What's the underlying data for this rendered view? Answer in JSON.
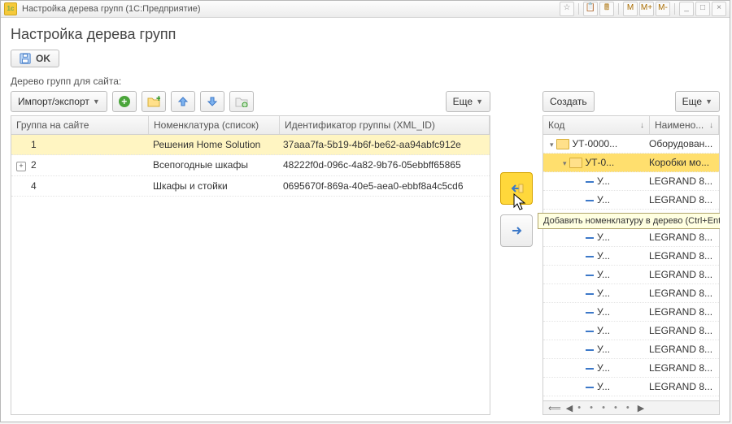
{
  "window": {
    "title": "Настройка дерева групп  (1С:Предприятие)"
  },
  "titlebar_buttons": [
    "☆",
    "📄",
    "🖩",
    "M",
    "M+",
    "M-",
    "_",
    "×"
  ],
  "page": {
    "heading": "Настройка дерева групп"
  },
  "ok_button": {
    "label": "OK"
  },
  "tree_label": "Дерево групп для сайта:",
  "left_toolbar": {
    "import_export": "Импорт/экспорт",
    "more": "Еще"
  },
  "left_table": {
    "headers": [
      "Группа на сайте",
      "Номенклатура (список)",
      "Идентификатор группы (XML_ID)"
    ],
    "rows": [
      {
        "num": "1",
        "expand": false,
        "nomen": "Решения Home Solution",
        "xml": "37aaa7fa-5b19-4b6f-be62-aa94abfc912e",
        "selected": true
      },
      {
        "num": "2",
        "expand": true,
        "nomen": "Всепогодные шкафы",
        "xml": "48222f0d-096c-4a82-9b76-05ebbff65865",
        "selected": false
      },
      {
        "num": "4",
        "expand": false,
        "nomen": "Шкафы и стойки",
        "xml": "0695670f-869a-40e5-aea0-ebbf8a4c5cd6",
        "selected": false
      }
    ]
  },
  "mid": {
    "tooltip": "Добавить номенклатуру в дерево (Ctrl+Enter)"
  },
  "right_toolbar": {
    "create": "Создать",
    "more": "Еще"
  },
  "right_table": {
    "headers": [
      "Код",
      "Наимено..."
    ],
    "rows": [
      {
        "level": 0,
        "type": "folder",
        "caret": "▾",
        "code": "УТ-0000...",
        "name": "Оборудован...",
        "selected": false
      },
      {
        "level": 1,
        "type": "folder",
        "caret": "▾",
        "code": "УТ-0...",
        "name": "Коробки мо...",
        "selected": true
      },
      {
        "level": 2,
        "type": "item",
        "code": "У...",
        "name": "LEGRAND 8..."
      },
      {
        "level": 2,
        "type": "item",
        "code": "У...",
        "name": "LEGRAND 8..."
      },
      {
        "level": 2,
        "type": "item",
        "code": "У...",
        "name": "LEGRAND 8..."
      },
      {
        "level": 2,
        "type": "item",
        "code": "У...",
        "name": "LEGRAND 8..."
      },
      {
        "level": 2,
        "type": "item",
        "code": "У...",
        "name": "LEGRAND 8..."
      },
      {
        "level": 2,
        "type": "item",
        "code": "У...",
        "name": "LEGRAND 8..."
      },
      {
        "level": 2,
        "type": "item",
        "code": "У...",
        "name": "LEGRAND 8..."
      },
      {
        "level": 2,
        "type": "item",
        "code": "У...",
        "name": "LEGRAND 8..."
      },
      {
        "level": 2,
        "type": "item",
        "code": "У...",
        "name": "LEGRAND 8..."
      },
      {
        "level": 2,
        "type": "item",
        "code": "У...",
        "name": "LEGRAND 8..."
      },
      {
        "level": 2,
        "type": "item",
        "code": "У...",
        "name": "LEGRAND 8..."
      },
      {
        "level": 2,
        "type": "item",
        "code": "У...",
        "name": "LEGRAND 8..."
      }
    ]
  }
}
